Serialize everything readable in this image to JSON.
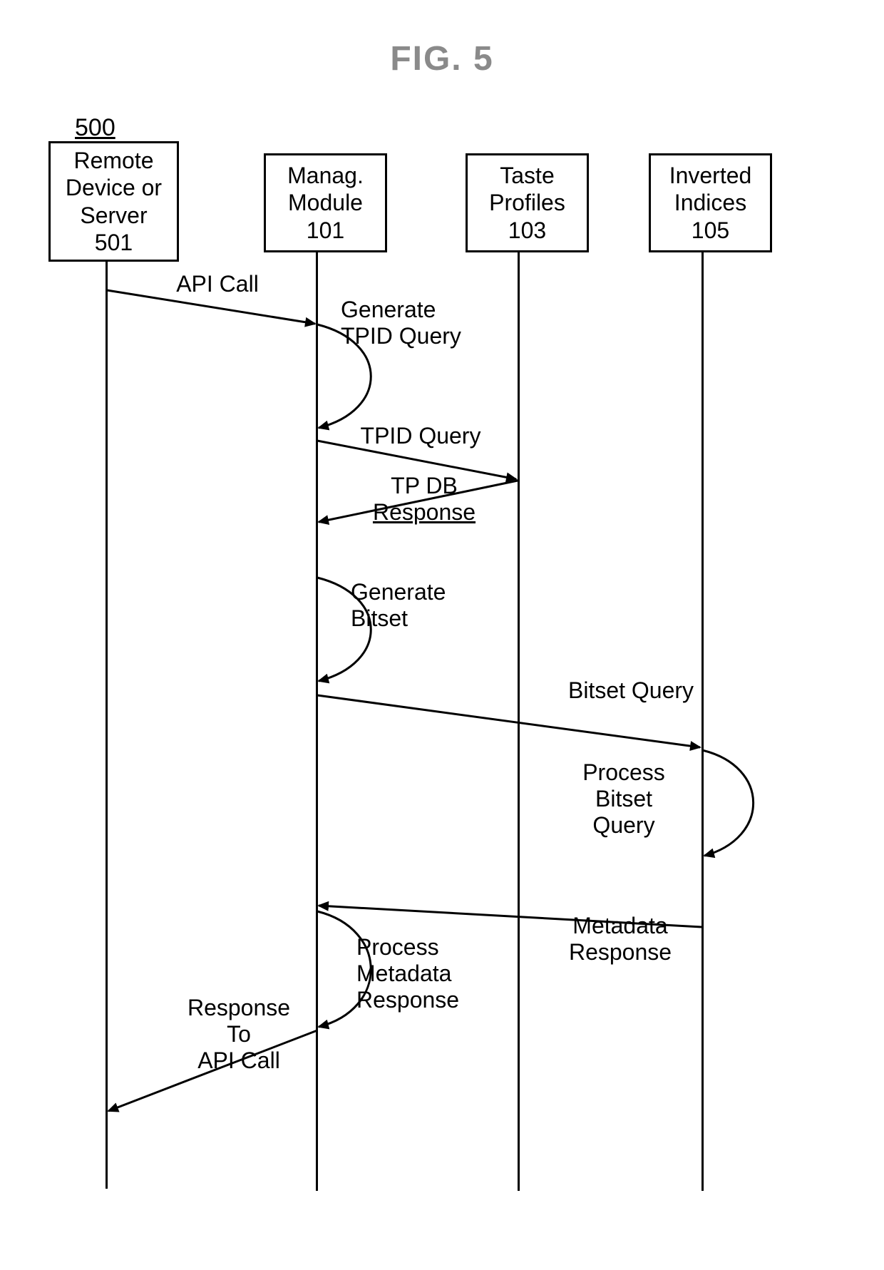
{
  "figure": {
    "title": "FIG. 5",
    "ref": "500"
  },
  "lifelines": {
    "remote": {
      "line1": "Remote",
      "line2": "Device or",
      "line3": "Server",
      "id": "501"
    },
    "manag": {
      "line1": "Manag.",
      "line2": "Module",
      "id": "101"
    },
    "taste": {
      "line1": "Taste",
      "line2": "Profiles",
      "id": "103"
    },
    "inv": {
      "line1": "Inverted",
      "line2": "Indices",
      "id": "105"
    }
  },
  "messages": {
    "api_call": "API Call",
    "gen_tpid": {
      "l1": "Generate",
      "l2": "TPID Query"
    },
    "tpid_query": "TPID Query",
    "tpdb_resp": {
      "l1": "TP DB",
      "l2": "Response"
    },
    "gen_bitset": {
      "l1": "Generate",
      "l2": "Bitset"
    },
    "bitset_query": "Bitset Query",
    "proc_bitset": {
      "l1": "Process",
      "l2": "Bitset",
      "l3": "Query"
    },
    "meta_resp": {
      "l1": "Metadata",
      "l2": "Response"
    },
    "proc_meta": {
      "l1": "Process",
      "l2": "Metadata",
      "l3": "Response"
    },
    "resp_api": {
      "l1": "Response",
      "l2": "To",
      "l3": "API Call"
    }
  }
}
